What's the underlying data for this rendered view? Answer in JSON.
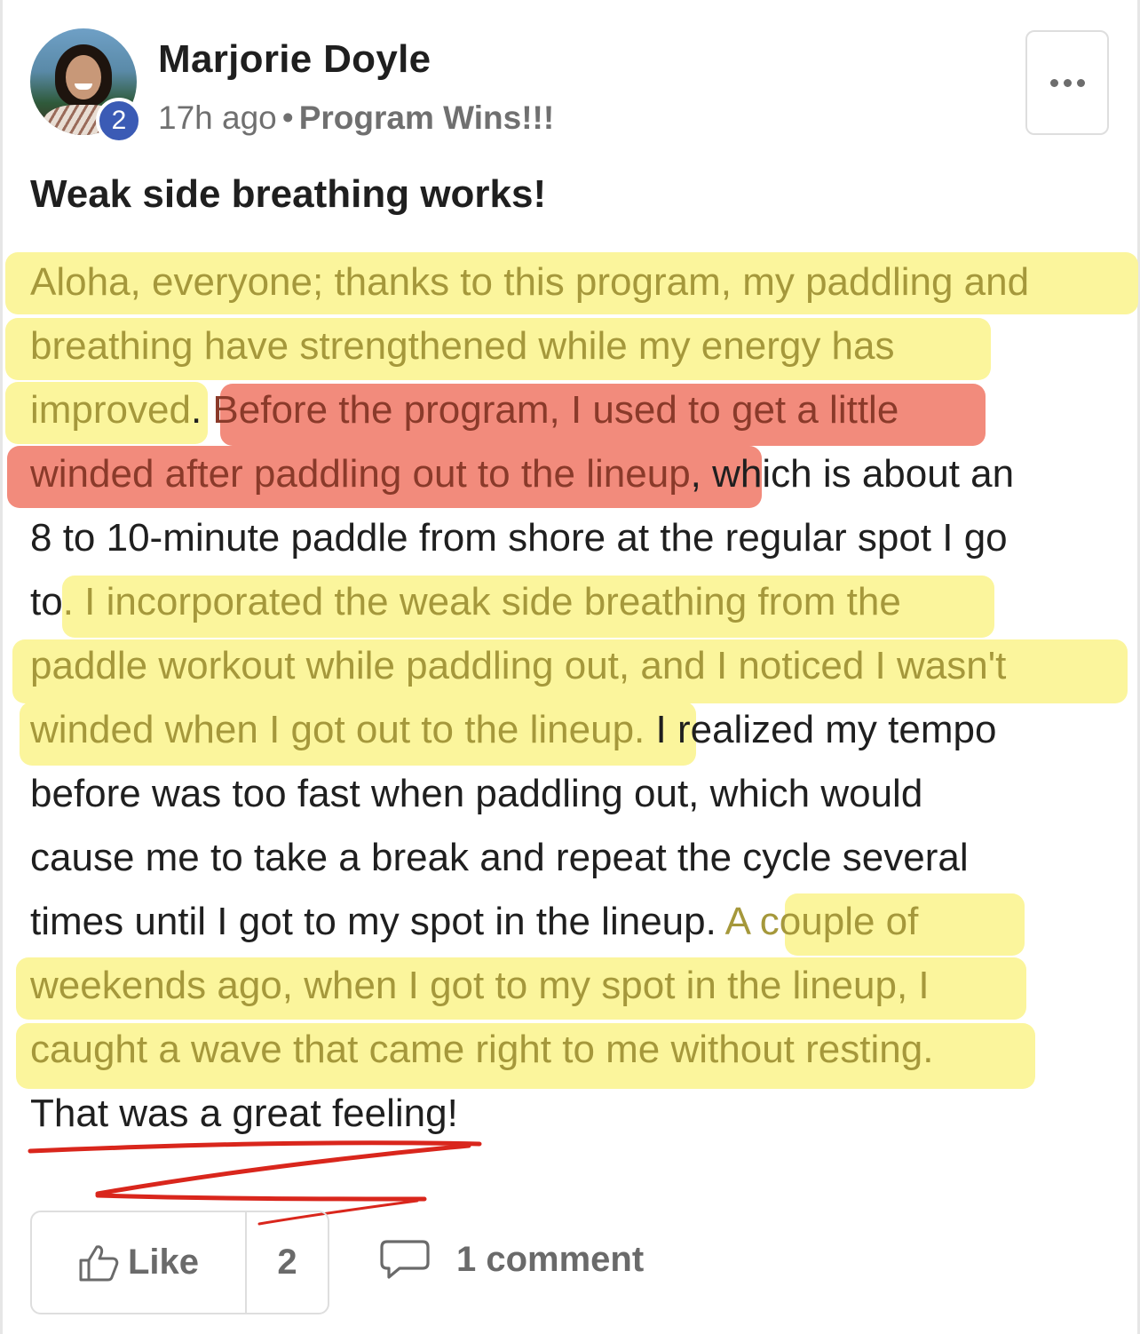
{
  "post": {
    "author": "Marjorie Doyle",
    "level_badge": "2",
    "time_ago": "17h ago",
    "separator": "•",
    "category": "Program Wins!!!",
    "title": "Weak side breathing works!",
    "body_segments": [
      {
        "id": "s1",
        "text": "Aloha, everyone; thanks to this program, my paddling and breathing have strengthened while my energy has improved",
        "highlight": "yellow"
      },
      {
        "id": "s2",
        "text": ". ",
        "highlight": "none"
      },
      {
        "id": "s3",
        "text": "Before the program, I used to get a little winded after paddling out to the lineup",
        "highlight": "red"
      },
      {
        "id": "s4",
        "text": ", which is about an 8 to 10-minute paddle from shore at the regular spot I go to",
        "highlight": "none"
      },
      {
        "id": "s5",
        "text": ". I incorporated the weak side breathing from the paddle workout while paddling out, and I noticed I wasn't winded when I got out to the lineup.",
        "highlight": "yellow"
      },
      {
        "id": "s6",
        "text": " I realized my tempo before was too fast when paddling out, which would cause me to take a break and repeat the cycle several times until I got to my spot in the lineup. ",
        "highlight": "none"
      },
      {
        "id": "s7",
        "text": "A couple of weekends ago, when I got to my spot in the lineup, I caught a wave that came right to me without resting.",
        "highlight": "yellow"
      },
      {
        "id": "s8",
        "text": " That was a great feeling!",
        "highlight": "none"
      }
    ],
    "body_lines": [
      "Aloha, everyone; thanks to this program, my paddling and",
      "breathing have strengthened while my energy has",
      "improved. Before the program, I used to get a little",
      "winded after paddling out to the lineup, which is about an",
      "8 to 10-minute paddle from shore at the regular spot I go",
      "to. I incorporated the weak side breathing from the",
      "paddle workout while paddling out, and I noticed I wasn't",
      "winded when I got out to the lineup. I realized my tempo",
      "before was too fast when paddling out, which would",
      "cause me to take a break and repeat the cycle several",
      "times until I got to my spot in the lineup. A couple of",
      "weekends ago, when I got to my spot in the lineup, I",
      "caught a wave that came right to me without resting.",
      "That was a great feeling!"
    ]
  },
  "footer": {
    "like_label": "Like",
    "like_count": "2",
    "comment_label": "1 comment"
  },
  "colors": {
    "yellow_highlight": "#fbf59c",
    "red_highlight": "#f28b7c",
    "badge_blue": "#3b5bb5",
    "ink_red": "#d9261c"
  },
  "icons": [
    "more-dots-icon",
    "thumbs-up-icon",
    "comment-icon"
  ]
}
